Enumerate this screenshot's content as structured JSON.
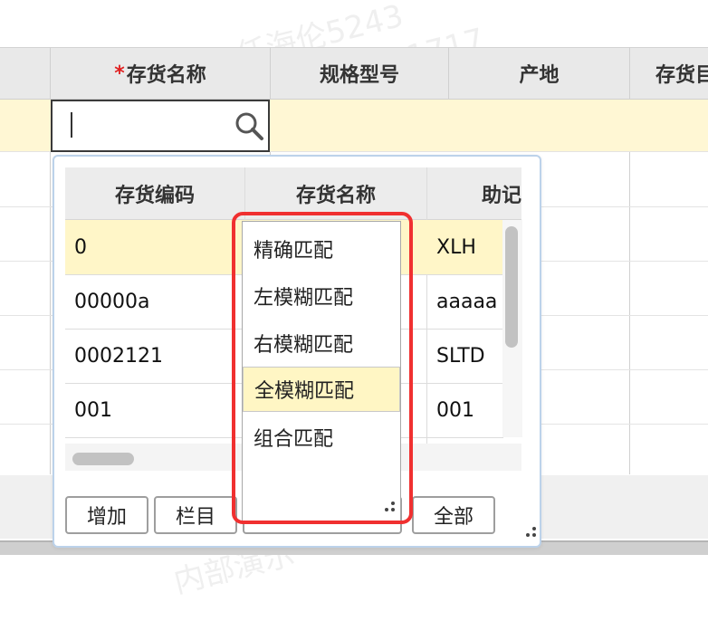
{
  "main_grid": {
    "columns": [
      {
        "label": "",
        "required": false
      },
      {
        "label": "存货名称",
        "required": true
      },
      {
        "label": "规格型号",
        "required": false
      },
      {
        "label": "产地",
        "required": false
      },
      {
        "label": "存货目",
        "required": false
      }
    ],
    "required_mark": "*",
    "edit_input_value": ""
  },
  "popup": {
    "columns": [
      "存货编码",
      "存货名称",
      "助记"
    ],
    "rows": [
      {
        "code": "0",
        "mnemonic": "XLH"
      },
      {
        "code": "00000a",
        "mnemonic": "aaaaa"
      },
      {
        "code": "0002121",
        "mnemonic": "SLTD"
      },
      {
        "code": "001",
        "mnemonic": "001"
      }
    ],
    "buttons": {
      "add": "增加",
      "columns": "栏目",
      "all": "全部"
    }
  },
  "match_dropdown": {
    "options": [
      "精确匹配",
      "左模糊匹配",
      "右模糊匹配",
      "全模糊匹配",
      "组合匹配"
    ],
    "selected_index": 3
  },
  "watermarks": [
    "任海伦5243",
    "内部演示7508121717",
    "内部演示"
  ],
  "colors": {
    "selected_row": "#fff7d4",
    "highlight_outline": "#f03030",
    "dropdown_selected": "#fff6c4"
  }
}
